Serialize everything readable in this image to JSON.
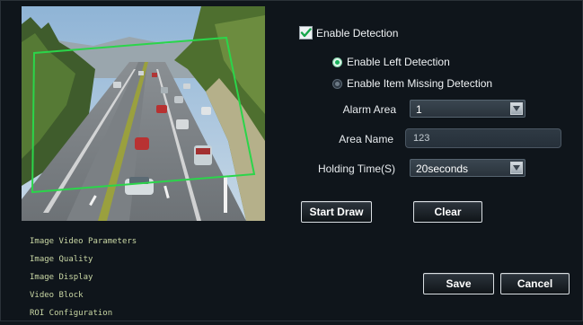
{
  "detection": {
    "enable_label": "Enable Detection",
    "enable_checked": true,
    "left_detection_label": "Enable Left Detection",
    "item_missing_label": "Enable Item Missing Detection",
    "mode_selected": "left"
  },
  "fields": {
    "alarm_area_label": "Alarm Area",
    "alarm_area_value": "1",
    "area_name_label": "Area Name",
    "area_name_value": "123",
    "holding_time_label": "Holding Time(S)",
    "holding_time_value": "20seconds"
  },
  "buttons": {
    "start_draw": "Start Draw",
    "clear": "Clear",
    "save": "Save",
    "cancel": "Cancel"
  },
  "menu": {
    "items": [
      "Image Video Parameters",
      "Image Quality",
      "Image Display",
      "Video Block",
      "ROI Configuration"
    ]
  },
  "colors": {
    "detection_region": "#2bd54a",
    "checkbox_check": "#15a64a",
    "radio_on": "#17b05a"
  },
  "icons": {
    "checkbox": "checkmark-icon",
    "select_arrow": "chevron-down-icon"
  }
}
